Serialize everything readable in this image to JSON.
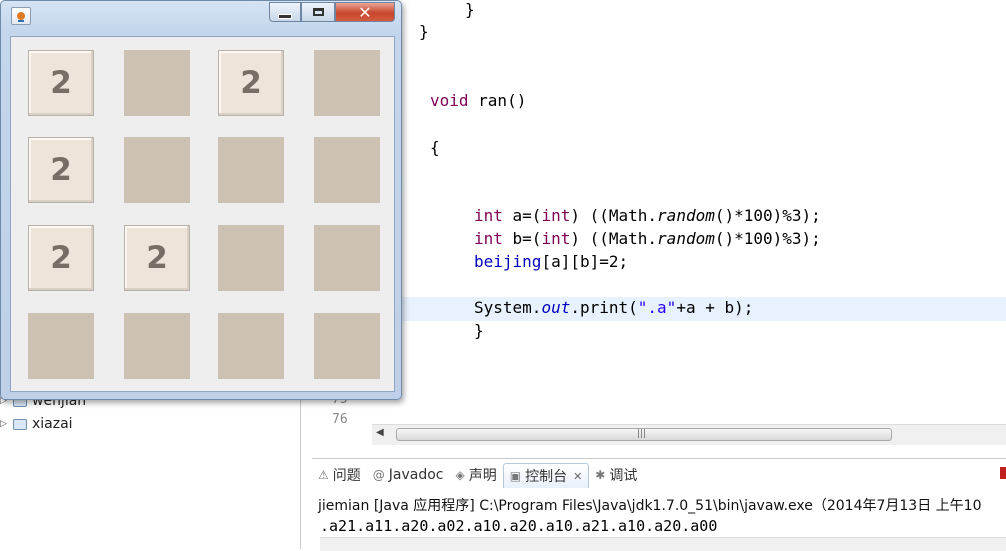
{
  "sidebar": {
    "items": [
      {
        "label": "wenjian"
      },
      {
        "label": "xiazai"
      }
    ]
  },
  "editor": {
    "line_numbers": [
      "75",
      "76"
    ],
    "code": {
      "brace1": "}",
      "brace2": "}",
      "void_kw": "void",
      "method_sig": " ran()",
      "open_brace": "{",
      "int_kw": "int",
      "line_a_mid": " a=(",
      "line_a_close": ") ((Math.",
      "random": "random",
      "tail": "()*100)%3);",
      "line_b_mid": " b=(",
      "beijing": "beijing",
      "beijing_tail": "[a][b]=2;",
      "system": "System.",
      "out": "out",
      "print": ".print(",
      "str": "\".a\"",
      "print_tail": "+a + b);",
      "close_brace": "}"
    }
  },
  "console": {
    "tabs": [
      {
        "icon": "problems-icon",
        "label": "问题"
      },
      {
        "icon": "javadoc-icon",
        "label": "Javadoc"
      },
      {
        "icon": "declaration-icon",
        "label": "声明"
      },
      {
        "icon": "console-icon",
        "label": "控制台",
        "active": true
      },
      {
        "icon": "debug-icon",
        "label": "调试"
      }
    ],
    "close_glyph": "✕",
    "path": "jiemian [Java 应用程序] C:\\Program Files\\Java\\jdk1.7.0_51\\bin\\javaw.exe（2014年7月13日 上午10",
    "output": ".a21.a11.a20.a02.a10.a20.a10.a21.a10.a20.a00"
  },
  "game": {
    "close_glyph": "✕",
    "grid": [
      [
        "2",
        "",
        "2",
        ""
      ],
      [
        "2",
        "",
        "",
        ""
      ],
      [
        "2",
        "2",
        "",
        ""
      ],
      [
        "",
        "",
        "",
        ""
      ]
    ],
    "colors": {
      "empty_tile": "#cdc1b4",
      "filled_tile": "#eee4da",
      "tile_text": "#776e65"
    }
  },
  "scrollbar": {
    "grip": "|||",
    "left_arrow": "◀"
  }
}
